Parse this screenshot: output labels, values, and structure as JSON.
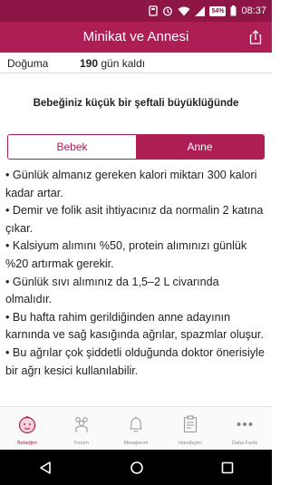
{
  "status_bar": {
    "time": "08:37",
    "battery_badge": "54%",
    "icons": [
      "notification-icon",
      "alarm-icon",
      "wifi-icon",
      "signal-icon",
      "battery-icon"
    ]
  },
  "app_bar": {
    "title": "Minikat ve Annesi",
    "share_icon": "share-icon"
  },
  "due": {
    "label": "Doğuma",
    "days": "190",
    "suffix": "gün kaldı"
  },
  "headline": "Bebeğiniz küçük bir şeftali büyüklüğünde",
  "segments": {
    "baby": "Bebek",
    "mother": "Anne",
    "selected": "Anne"
  },
  "bullets": [
    "Günlük almanız gereken kalori miktarı 300 kalori kadar artar.",
    "Demir ve folik asit ihtiyacınız da normalin 2 katına çıkar.",
    "Kalsiyum alımını %50, protein alımınızı günlük %20 artırmak gerekir.",
    "Günlük sıvı alımınız da 1,5–2 L civarında olmalıdır.",
    "Bu hafta rahim gerildiğinden anne adayının karnında ve sağ kasığında ağrılar, spazmlar oluşur.",
    "Bu ağrılar çok şiddetli olduğunda doktor önerisiyle bir ağrı kesici kullanılabilir."
  ],
  "tabs": [
    {
      "label": "Bebeğim",
      "icon": "baby-face-icon"
    },
    {
      "label": "Forum",
      "icon": "forum-icon"
    },
    {
      "label": "Mesajlarım",
      "icon": "bell-icon"
    },
    {
      "label": "Hamileyim",
      "icon": "clipboard-icon"
    },
    {
      "label": "Daha Fazla",
      "icon": "more-icon"
    }
  ],
  "colors": {
    "accent": "#ad1e55",
    "status_bar": "#8e1646"
  }
}
